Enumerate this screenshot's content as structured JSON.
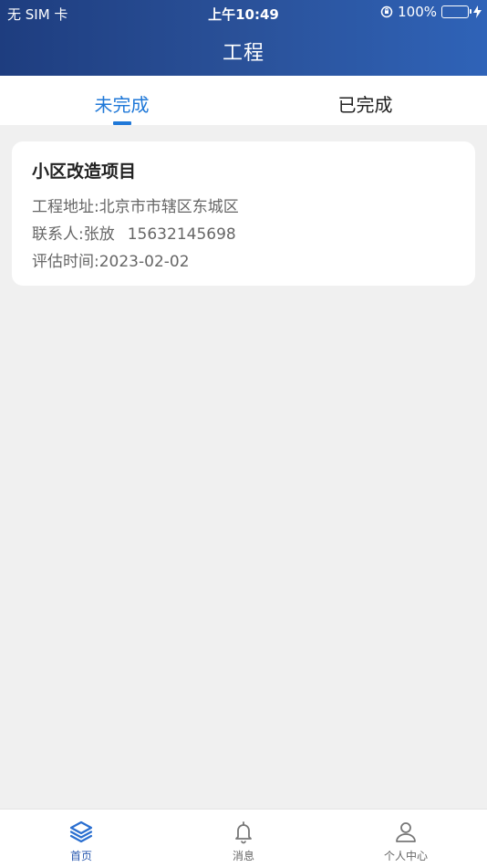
{
  "status_bar": {
    "carrier": "无 SIM 卡",
    "time": "上午10:49",
    "battery": "100%"
  },
  "nav": {
    "title": "工程"
  },
  "tabs": [
    {
      "label": "未完成",
      "active": true
    },
    {
      "label": "已完成",
      "active": false
    }
  ],
  "project": {
    "name": "小区改造项目",
    "address_label": "工程地址:",
    "address": "北京市市辖区东城区",
    "contact_label": "联系人:",
    "contact_name": "张放",
    "contact_phone": "15632145698",
    "date_label": "评估时间:",
    "date": "2023-02-02"
  },
  "tabbar": [
    {
      "label": "首页",
      "icon": "layers-icon",
      "active": true
    },
    {
      "label": "消息",
      "icon": "bell-icon",
      "active": false
    },
    {
      "label": "个人中心",
      "icon": "user-icon",
      "active": false
    }
  ],
  "colors": {
    "header_start": "#1e3d7f",
    "header_end": "#2f63b8",
    "accent": "#1f78d8",
    "battery": "#4cd964"
  }
}
